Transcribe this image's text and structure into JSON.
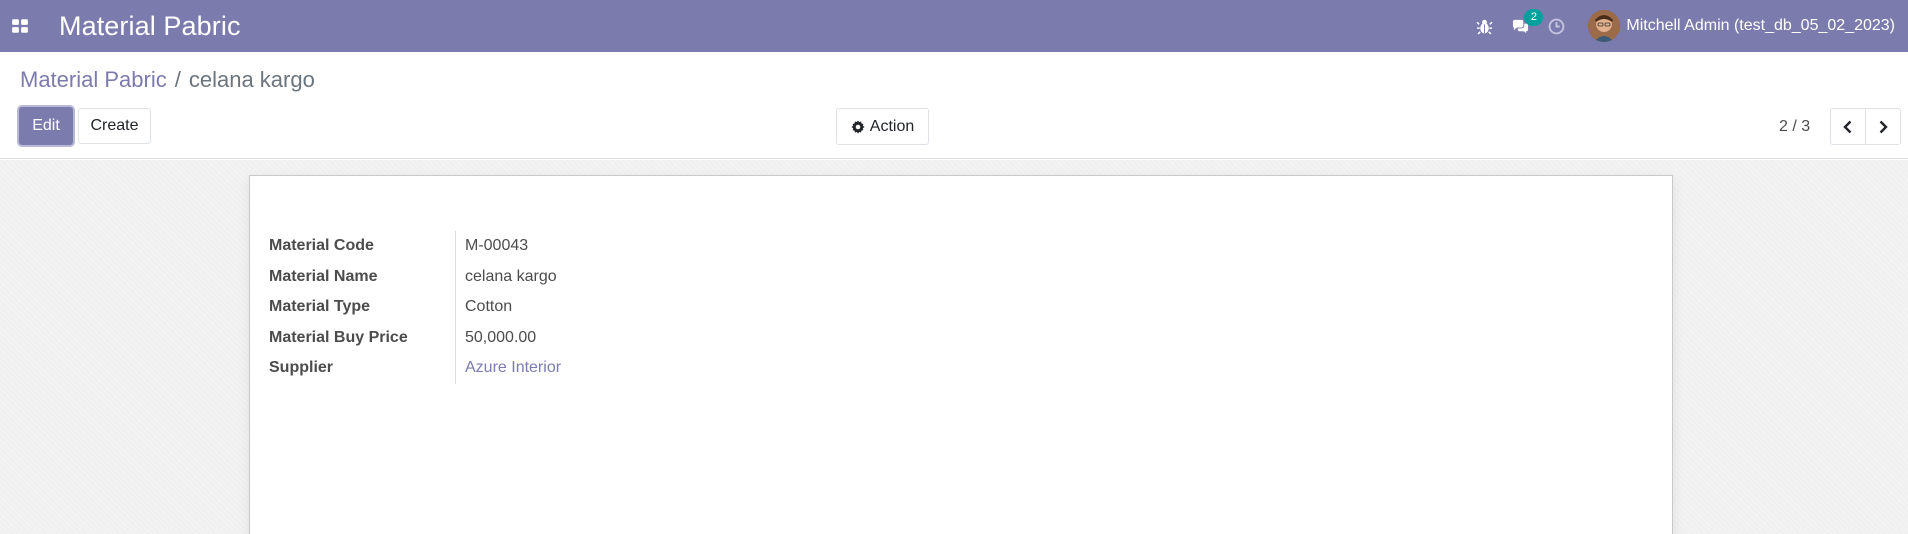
{
  "navbar": {
    "app_title": "Material Pabric",
    "messages_badge": "2",
    "user_name": "Mitchell Admin (test_db_05_02_2023)",
    "accent_color": "#7c7bad",
    "badge_color": "#00a09d",
    "icons": [
      "apps-grid-icon",
      "bug-icon",
      "chat-icon",
      "clock-icon"
    ]
  },
  "breadcrumb": {
    "parent": "Material Pabric",
    "separator": "/",
    "current": "celana kargo"
  },
  "buttons": {
    "edit": "Edit",
    "create": "Create",
    "action": "Action"
  },
  "pager": {
    "value": "2 / 3"
  },
  "form": {
    "fields": [
      {
        "label": "Material Code",
        "value": "M-00043"
      },
      {
        "label": "Material Name",
        "value": "celana kargo"
      },
      {
        "label": "Material Type",
        "value": "Cotton"
      },
      {
        "label": "Material Buy Price",
        "value": "50,000.00"
      },
      {
        "label": "Supplier",
        "value": "Azure Interior"
      }
    ]
  }
}
